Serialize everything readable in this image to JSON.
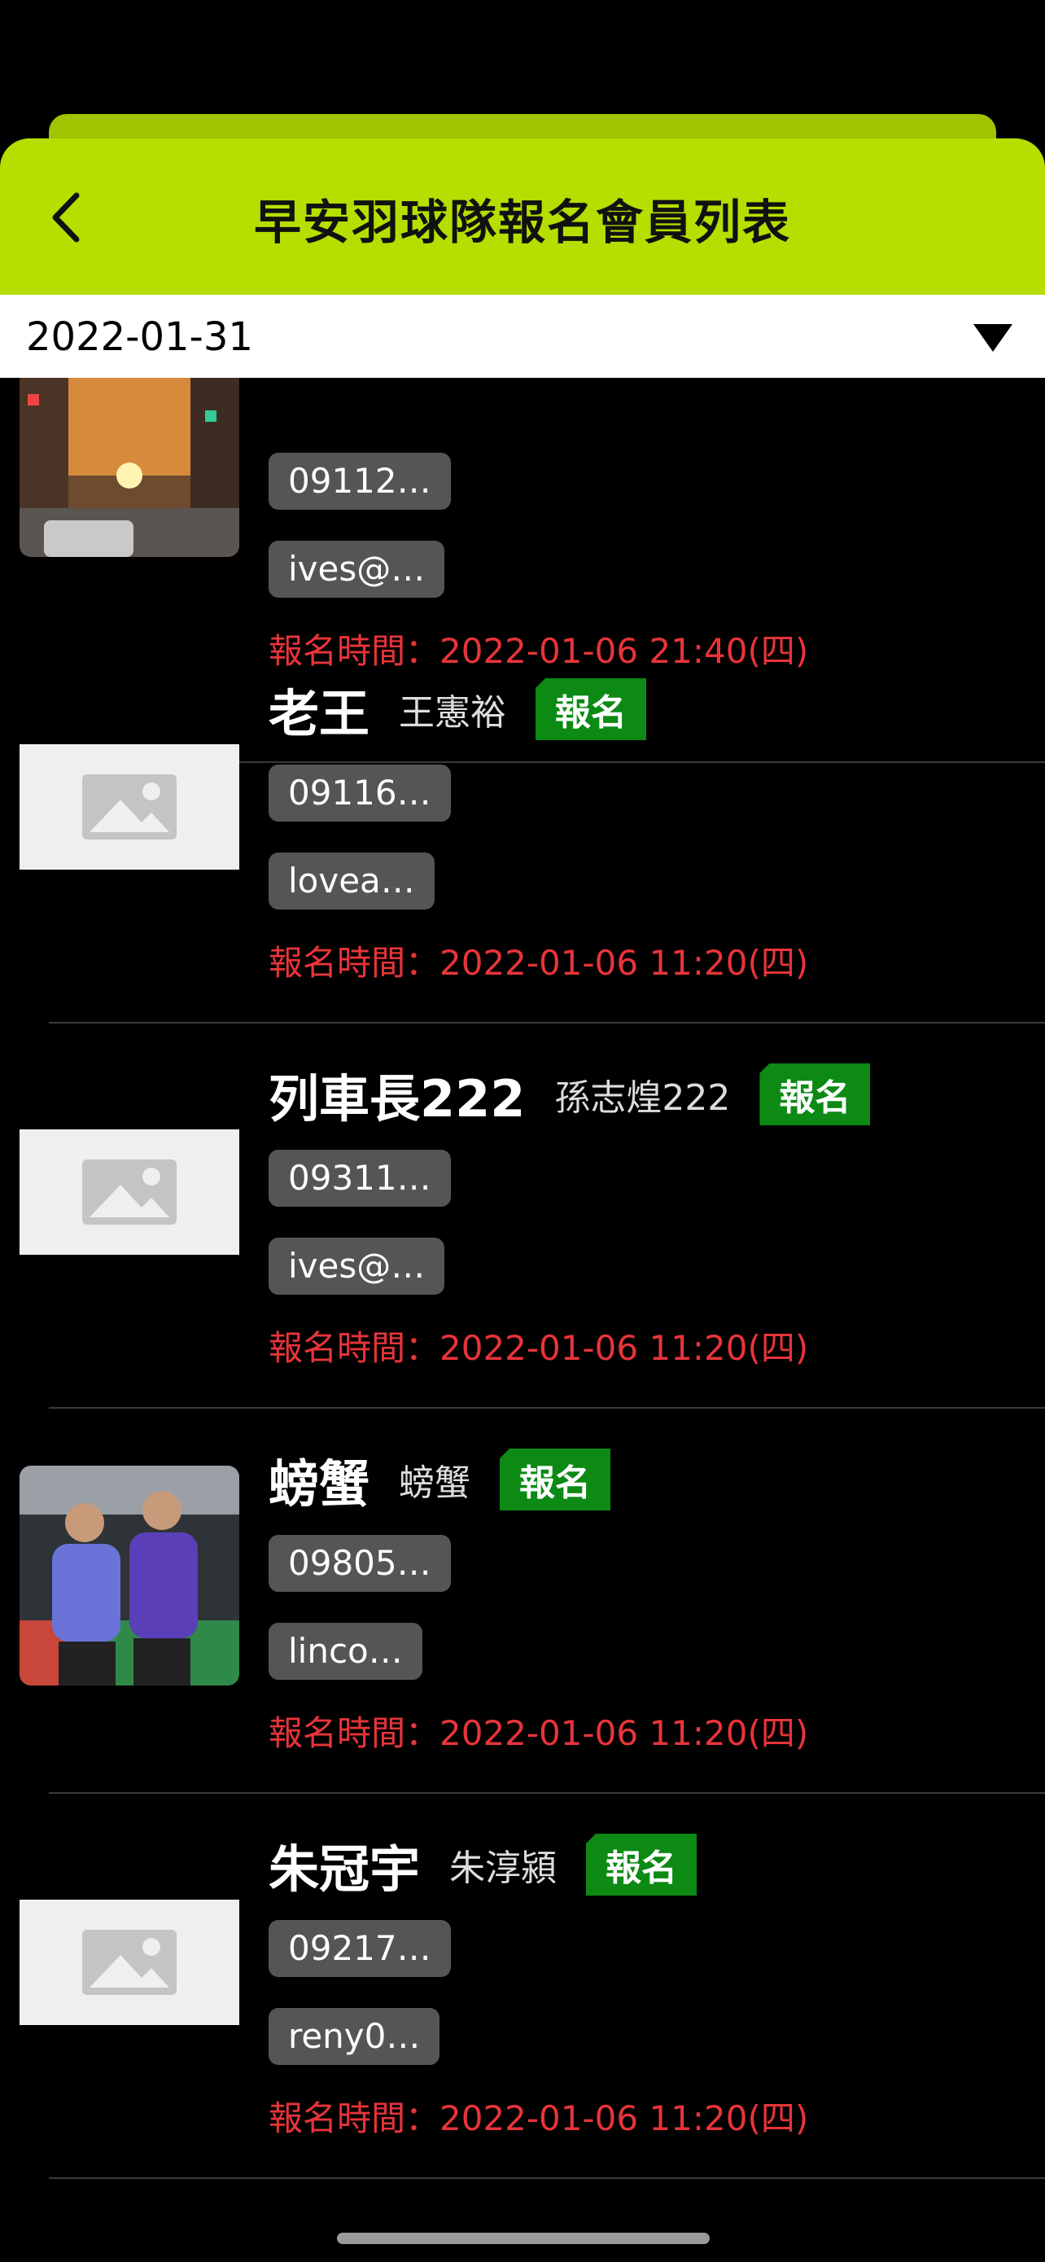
{
  "header": {
    "title": "早安羽球隊報名會員列表",
    "back_icon": "chevron-left-icon"
  },
  "date_picker": {
    "value": "2022-01-31",
    "icon": "triangle-down-icon"
  },
  "time_prefix": "報名時間：",
  "members": [
    {
      "nickname": "",
      "realname": "",
      "badge": "",
      "phone": "09112…",
      "email": "ives@…",
      "time": "2022-01-06 21:40(四)",
      "avatar": "street-photo"
    },
    {
      "nickname": "老王",
      "realname": "王憲裕",
      "badge": "報名",
      "phone": "09116…",
      "email": "lovea…",
      "time": "2022-01-06 11:20(四)",
      "avatar": "placeholder"
    },
    {
      "nickname": "列車長222",
      "realname": "孫志煌222",
      "badge": "報名",
      "phone": "09311…",
      "email": "ives@…",
      "time": "2022-01-06 11:20(四)",
      "avatar": "placeholder"
    },
    {
      "nickname": "螃蟹",
      "realname": "螃蟹",
      "badge": "報名",
      "phone": "09805…",
      "email": "linco…",
      "time": "2022-01-06 11:20(四)",
      "avatar": "players-photo"
    },
    {
      "nickname": "朱冠宇",
      "realname": "朱淳潁",
      "badge": "報名",
      "phone": "09217…",
      "email": "reny0…",
      "time": "2022-01-06 11:20(四)",
      "avatar": "placeholder"
    }
  ]
}
